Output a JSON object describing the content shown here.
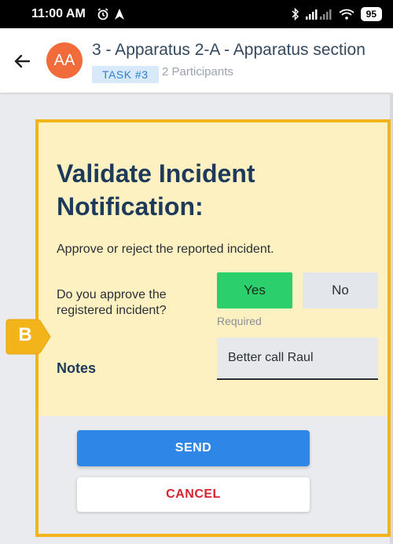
{
  "status_bar": {
    "time": "11:00 AM",
    "battery": "95"
  },
  "header": {
    "avatar_initials": "AA",
    "avatar_color": "#f26b3a",
    "title": "3 - Apparatus 2-A - Apparatus section",
    "task_badge": "TASK #3",
    "participants": "2 Participants"
  },
  "form": {
    "heading": "Validate Incident Notification:",
    "instruction": "Approve or reject the reported incident.",
    "question": "Do you approve the registered incident?",
    "yes_label": "Yes",
    "no_label": "No",
    "required_hint": "Required",
    "notes_label": "Notes",
    "notes_value": "Better call Raul"
  },
  "actions": {
    "send_label": "SEND",
    "cancel_label": "CANCEL"
  },
  "marker": {
    "letter": "B",
    "color": "#f3b41b"
  },
  "colors": {
    "highlight_border": "#f3b41b",
    "yes_green": "#2bcf6b",
    "send_blue": "#2e86e6",
    "cancel_red": "#d9232e"
  },
  "icons": {
    "back": "arrow-back-icon",
    "alarm": "alarm-icon",
    "navigation": "navigation-icon",
    "bluetooth": "bluetooth-icon",
    "signal": "signal-icon",
    "wifi": "wifi-icon"
  }
}
